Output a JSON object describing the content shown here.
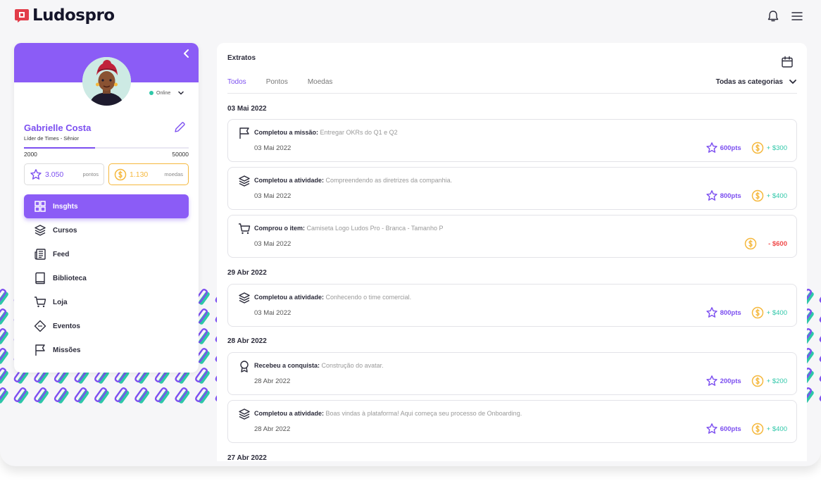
{
  "app": {
    "brand": "Ludospro"
  },
  "sidebar": {
    "status": "Online",
    "user_name": "Gabrielle Costa",
    "user_role": "Líder de Times - Sênior",
    "level_min": "2000",
    "level_max": "50000",
    "level_progress": 0.43,
    "points_value": "3.050",
    "points_label": "pontos",
    "coins_value": "1.130",
    "coins_label": "moedas",
    "nav": [
      {
        "label": "Insghts",
        "icon": "grid-icon"
      },
      {
        "label": "Cursos",
        "icon": "layers-icon"
      },
      {
        "label": "Feed",
        "icon": "newspaper-icon"
      },
      {
        "label": "Biblioteca",
        "icon": "book-icon"
      },
      {
        "label": "Loja",
        "icon": "cart-icon"
      },
      {
        "label": "Eventos",
        "icon": "ticket-icon"
      },
      {
        "label": "Missões",
        "icon": "flag-icon"
      }
    ]
  },
  "main": {
    "title": "Extratos",
    "tabs": [
      "Todos",
      "Pontos",
      "Moedas"
    ],
    "category_select": "Todas as categorias",
    "groups": [
      {
        "date": "03 Mai 2022"
      },
      {
        "date": "29 Abr 2022"
      },
      {
        "date": "28 Abr 2022"
      },
      {
        "date": "27 Abr 2022"
      }
    ],
    "entries": [
      {
        "icon": "flag-icon",
        "action": "Completou a missão:",
        "detail": "Entregar OKRs do Q1 e Q2",
        "date": "03 Mai 2022",
        "points": "600pts",
        "coins": "+ $300"
      },
      {
        "icon": "layers-icon",
        "action": "Completou a atividade:",
        "detail": "Compreendendo as diretrizes da companhia.",
        "date": "03 Mai 2022",
        "points": "800pts",
        "coins": "+ $400"
      },
      {
        "icon": "cart-icon",
        "action": "Comprou o item:",
        "detail": "Camiseta Logo Ludos Pro - Branca - Tamanho P",
        "date": "03 Mai 2022",
        "coins": "- $600"
      },
      {
        "icon": "layers-icon",
        "action": "Completou a atividade:",
        "detail": "Conhecendo o time comercial.",
        "date": "03 Mai 2022",
        "points": "800pts",
        "coins": "+ $400"
      },
      {
        "icon": "award-icon",
        "action": "Recebeu a conquista:",
        "detail": "Construção do avatar.",
        "date": "28 Abr 2022",
        "points": "200pts",
        "coins": "+ $200"
      },
      {
        "icon": "layers-icon",
        "action": "Completou a atividade:",
        "detail": "Boas vindas à plataforma! Aqui começa seu processo de Onboarding.",
        "date": "28 Abr 2022",
        "points": "600pts",
        "coins": "+ $400"
      }
    ]
  },
  "colors": {
    "accent": "#8b5cf6",
    "coin": "#f5b83d",
    "positive": "#2ec7a8",
    "negative": "#f04a4a"
  }
}
